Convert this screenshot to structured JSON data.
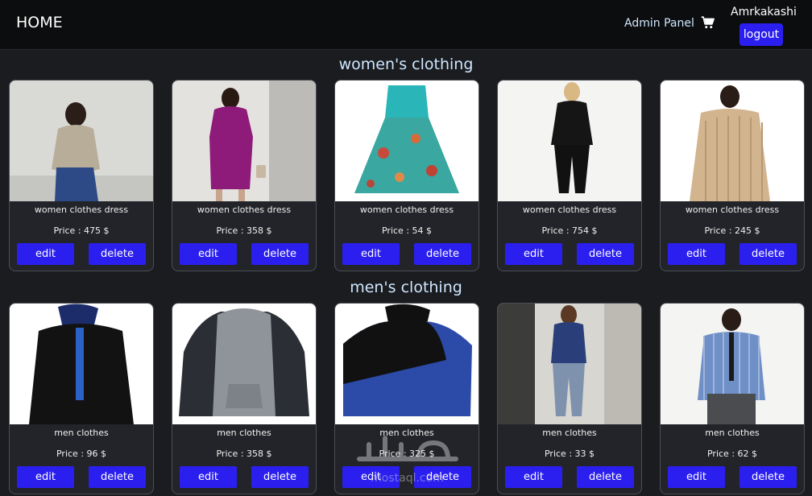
{
  "nav": {
    "brand": "HOME",
    "admin_link": "Admin Panel",
    "cart_icon": "shopping-cart-icon",
    "username": "Amrkakashi",
    "logout_label": "logout"
  },
  "accent_color": "#2b1ff0",
  "sections": [
    {
      "title": "women's clothing",
      "products": [
        {
          "title": "women clothes dress",
          "price": "Price : 475 $",
          "edit": "edit",
          "delete": "delete"
        },
        {
          "title": "women clothes dress",
          "price": "Price : 358 $",
          "edit": "edit",
          "delete": "delete"
        },
        {
          "title": "women clothes dress",
          "price": "Price : 54 $",
          "edit": "edit",
          "delete": "delete"
        },
        {
          "title": "women clothes dress",
          "price": "Price : 754 $",
          "edit": "edit",
          "delete": "delete"
        },
        {
          "title": "women clothes dress",
          "price": "Price : 245 $",
          "edit": "edit",
          "delete": "delete"
        }
      ]
    },
    {
      "title": "men's clothing",
      "products": [
        {
          "title": "men clothes",
          "price": "Price : 96 $",
          "edit": "edit",
          "delete": "delete"
        },
        {
          "title": "men clothes",
          "price": "Price : 358 $",
          "edit": "edit",
          "delete": "delete"
        },
        {
          "title": "men clothes",
          "price": "Price : 325 $",
          "edit": "edit",
          "delete": "delete"
        },
        {
          "title": "men clothes",
          "price": "Price : 33 $",
          "edit": "edit",
          "delete": "delete"
        },
        {
          "title": "men clothes",
          "price": "Price : 62 $",
          "edit": "edit",
          "delete": "delete"
        }
      ]
    }
  ],
  "watermark": {
    "text": "mostaql.com"
  }
}
